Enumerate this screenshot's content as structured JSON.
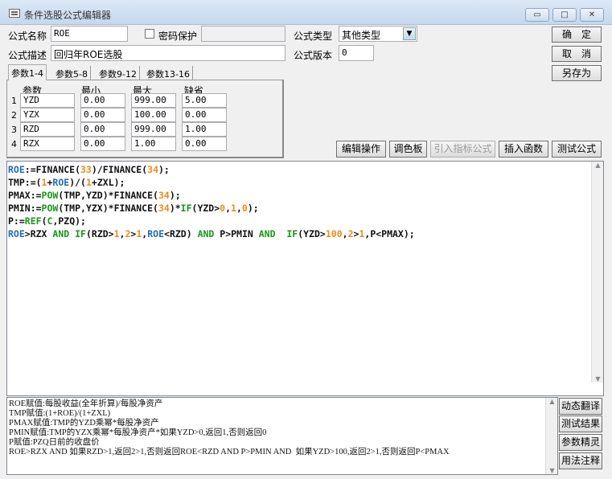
{
  "window": {
    "title": "条件选股公式编辑器",
    "minimize": "▭",
    "maximize": "□",
    "close": "✕"
  },
  "form": {
    "name_label": "公式名称",
    "name_value": "ROE",
    "password_label": "密码保护",
    "password_value": "",
    "type_label": "公式类型",
    "type_value": "其他类型",
    "desc_label": "公式描述",
    "desc_value": "回归年ROE选股",
    "version_label": "公式版本",
    "version_value": "0"
  },
  "actions": {
    "ok": "确　定",
    "cancel": "取　消",
    "save_as": "另存为"
  },
  "tabs": [
    "参数1-4",
    "参数5-8",
    "参数9-12",
    "参数13-16"
  ],
  "params": {
    "headers": [
      "参数",
      "最小",
      "最大",
      "缺省"
    ],
    "rows": [
      {
        "n": "1",
        "name": "YZD",
        "min": "0.00",
        "max": "999.00",
        "def": "5.00"
      },
      {
        "n": "2",
        "name": "YZX",
        "min": "0.00",
        "max": "100.00",
        "def": "0.00"
      },
      {
        "n": "3",
        "name": "RZD",
        "min": "0.00",
        "max": "999.00",
        "def": "1.00"
      },
      {
        "n": "4",
        "name": "RZX",
        "min": "0.00",
        "max": "1.00",
        "def": "0.00"
      }
    ]
  },
  "toolbar": [
    "编辑操作",
    "调色板",
    "引入指标公式",
    "插入函数",
    "测试公式"
  ],
  "code": [
    [
      [
        "ROE",
        "k"
      ],
      [
        ":=FINANCE(",
        "t"
      ],
      [
        "33",
        "n"
      ],
      [
        ")/FINANCE(",
        "t"
      ],
      [
        "34",
        "n"
      ],
      [
        ");",
        "t"
      ]
    ],
    [
      [
        "TMP:=(",
        "t"
      ],
      [
        "1",
        "n"
      ],
      [
        "+",
        "t"
      ],
      [
        "ROE",
        "k"
      ],
      [
        ")/(",
        "t"
      ],
      [
        "1",
        "n"
      ],
      [
        "+ZXL);",
        "t"
      ]
    ],
    [
      [
        "PMAX:=",
        "t"
      ],
      [
        "POW",
        "f"
      ],
      [
        "(TMP,YZD)*FINANCE(",
        "t"
      ],
      [
        "34",
        "n"
      ],
      [
        ");",
        "t"
      ]
    ],
    [
      [
        "PMIN:=",
        "t"
      ],
      [
        "POW",
        "f"
      ],
      [
        "(TMP,YZX)*FINANCE(",
        "t"
      ],
      [
        "34",
        "n"
      ],
      [
        ")*",
        "t"
      ],
      [
        "IF",
        "f"
      ],
      [
        "(YZD>",
        "t"
      ],
      [
        "0",
        "n"
      ],
      [
        ",",
        "t"
      ],
      [
        "1",
        "n"
      ],
      [
        ",",
        "t"
      ],
      [
        "0",
        "n"
      ],
      [
        ");",
        "t"
      ]
    ],
    [
      [
        "P:=",
        "t"
      ],
      [
        "REF",
        "f"
      ],
      [
        "(",
        "t"
      ],
      [
        "C",
        "f"
      ],
      [
        ",PZQ);",
        "t"
      ]
    ],
    [
      [
        "ROE",
        "k"
      ],
      [
        ">RZX ",
        "t"
      ],
      [
        "AND",
        "f"
      ],
      [
        " ",
        "t"
      ],
      [
        "IF",
        "f"
      ],
      [
        "(RZD>",
        "t"
      ],
      [
        "1",
        "n"
      ],
      [
        ",",
        "t"
      ],
      [
        "2",
        "n"
      ],
      [
        ">",
        "t"
      ],
      [
        "1",
        "n"
      ],
      [
        ",",
        "t"
      ],
      [
        "ROE",
        "k"
      ],
      [
        "<RZD) ",
        "t"
      ],
      [
        "AND",
        "f"
      ],
      [
        " P>PMIN ",
        "t"
      ],
      [
        "AND",
        "f"
      ],
      [
        "  ",
        "t"
      ],
      [
        "IF",
        "f"
      ],
      [
        "(YZD>",
        "t"
      ],
      [
        "100",
        "n"
      ],
      [
        ",",
        "t"
      ],
      [
        "2",
        "n"
      ],
      [
        ">",
        "t"
      ],
      [
        "1",
        "n"
      ],
      [
        ",P<PMAX);",
        "t"
      ]
    ]
  ],
  "notes": [
    "ROE赋值:每股收益(全年折算)/每股净资产",
    "TMP赋值:(1+ROE)/(1+ZXL)",
    "PMAX赋值:TMP的YZD乘幂*每股净资产",
    "PMIN赋值:TMP的YZX乘幂*每股净资产*如果YZD>0,返回1,否则返回0",
    "P赋值:PZQ日前的收盘价",
    "ROE>RZX AND 如果RZD>1,返回2>1,否则返回ROE<RZD AND P>PMIN AND  如果YZD>100,返回2>1,否则返回P<PMAX"
  ],
  "side_buttons": [
    "动态翻译",
    "测试结果",
    "参数精灵",
    "用法注释"
  ],
  "colors": {
    "keyword": "#1e6bb8",
    "number": "#ef8a1a",
    "function": "#1a961a"
  }
}
